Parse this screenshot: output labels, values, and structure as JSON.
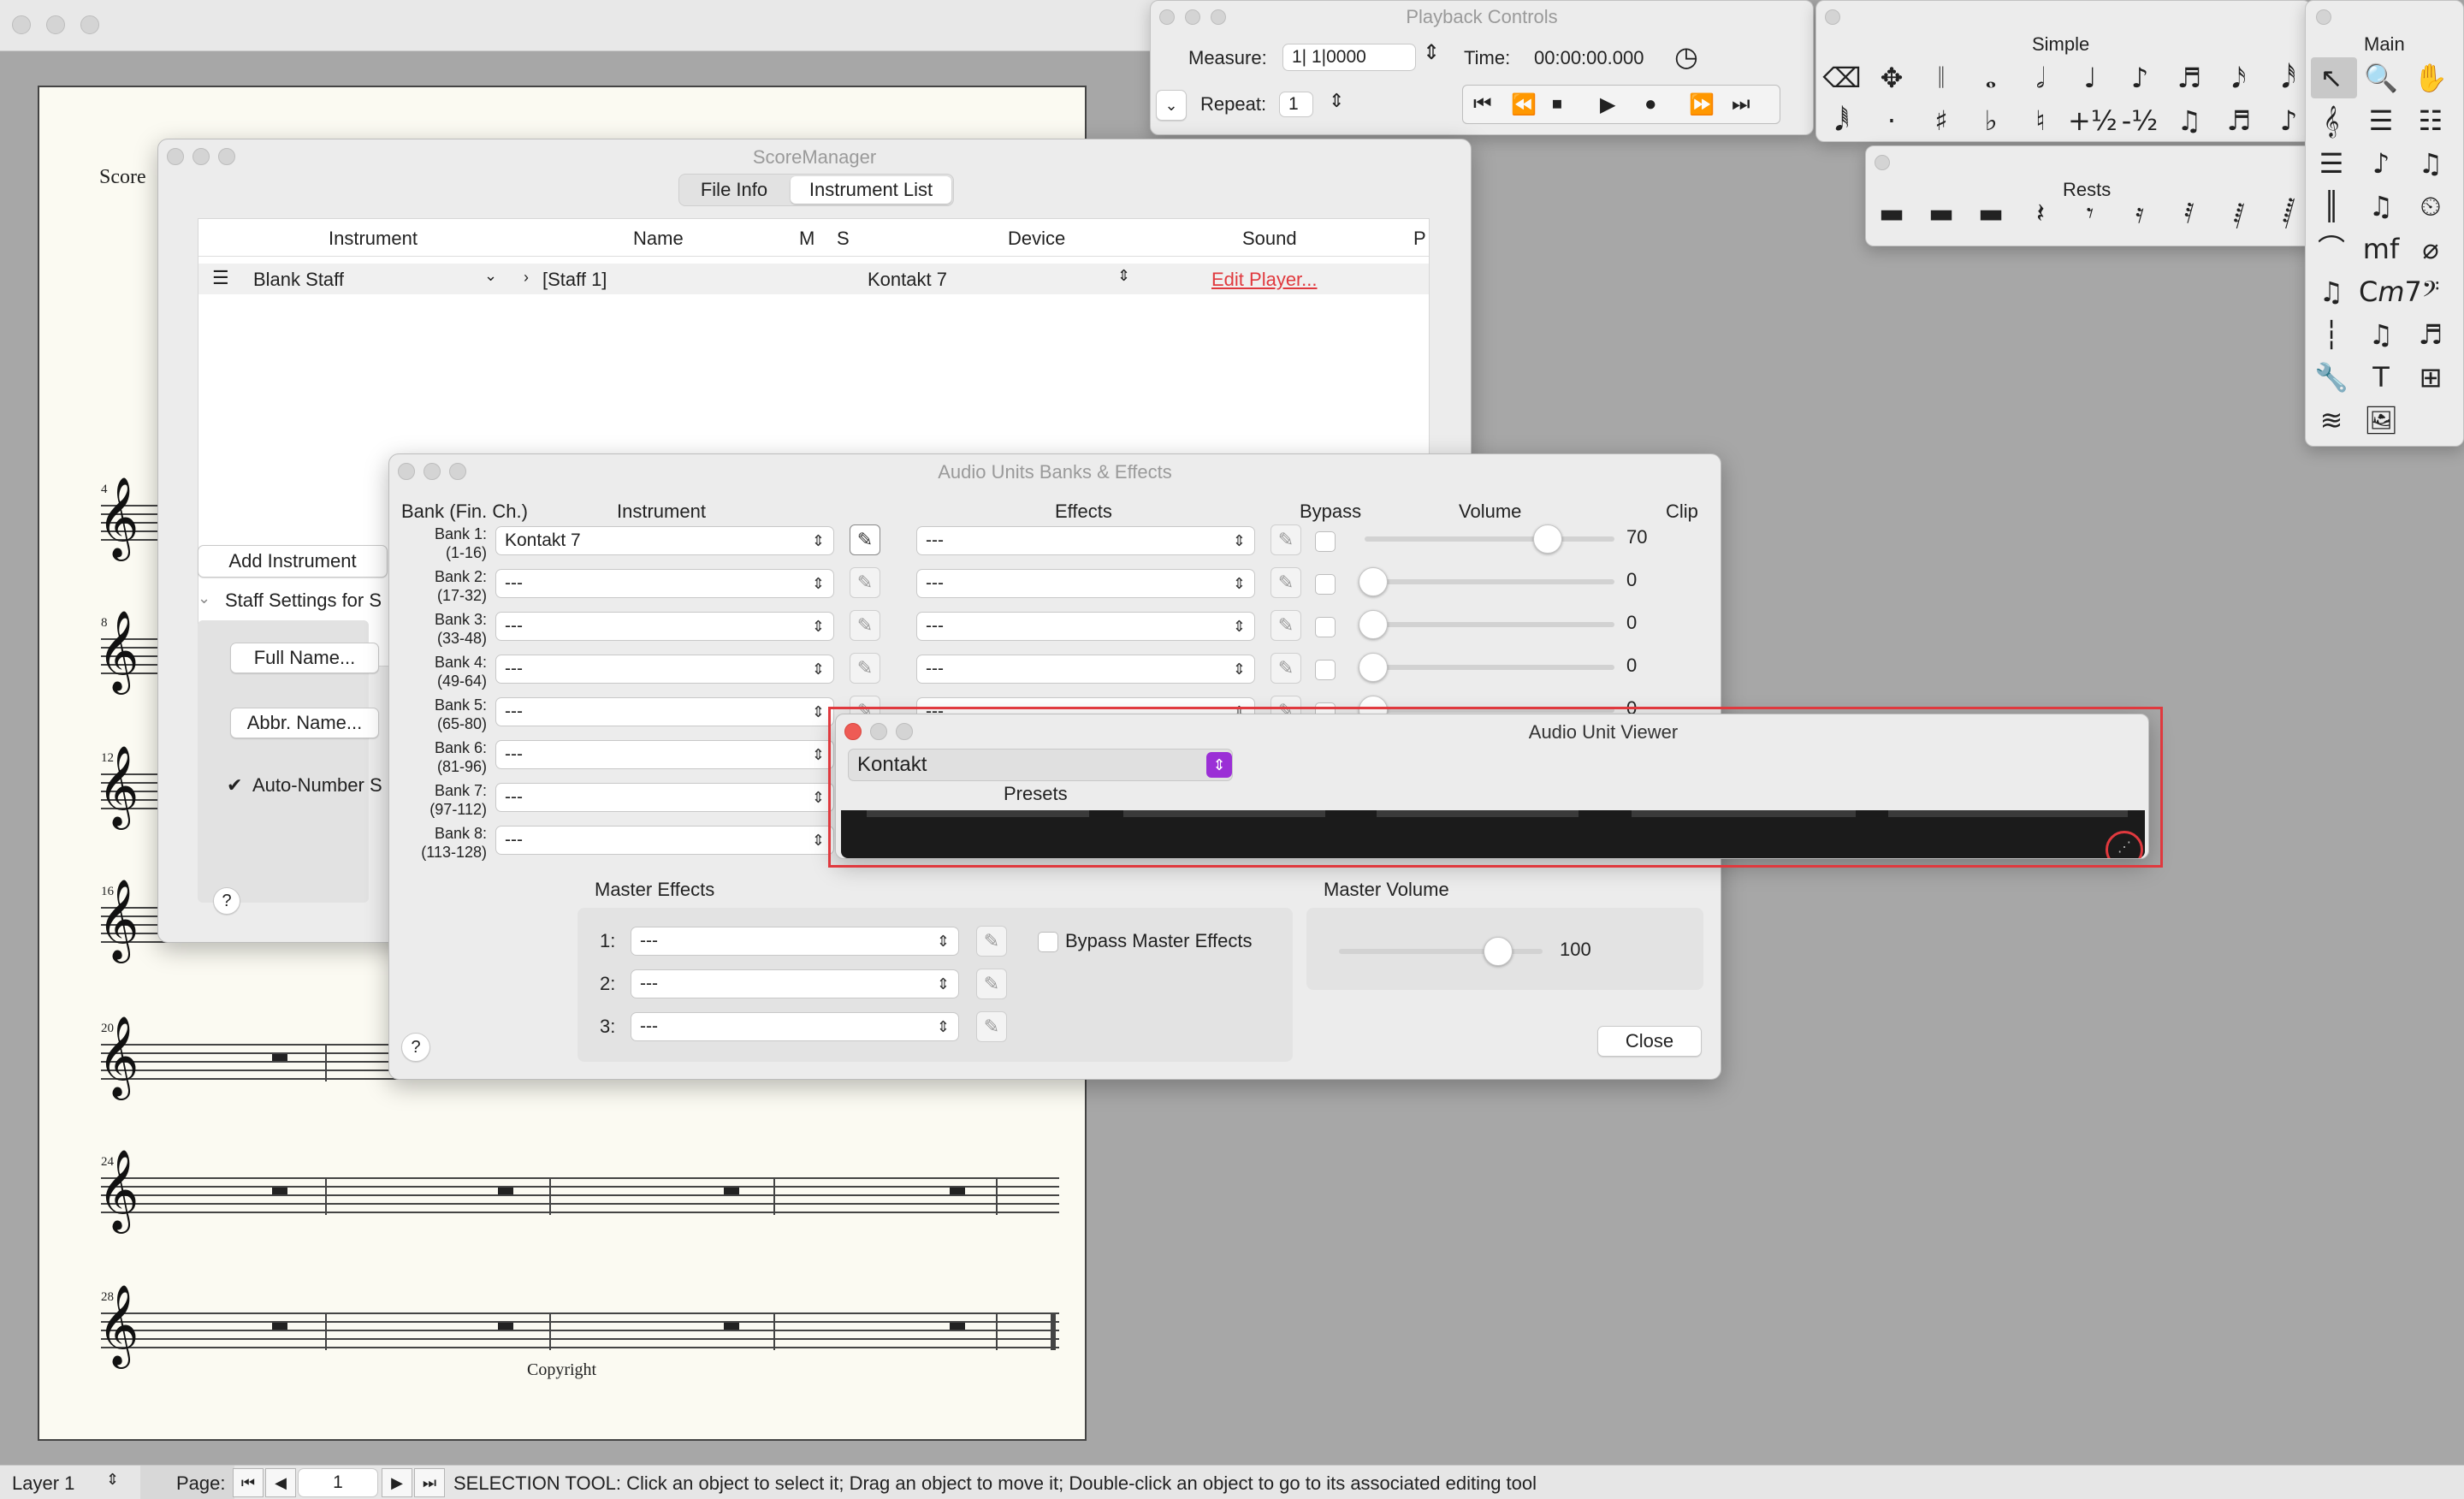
{
  "score": {
    "label": "Score",
    "measure_numbers": [
      "4",
      "8",
      "12",
      "16",
      "20",
      "24",
      "28"
    ],
    "copyright": "Copyright"
  },
  "score_manager": {
    "title": "ScoreManager",
    "tabs": [
      "File Info",
      "Instrument List"
    ],
    "active_tab": "Instrument List",
    "columns": [
      "Instrument",
      "Name",
      "M",
      "S",
      "Device",
      "Sound",
      "P"
    ],
    "row": {
      "instrument": "Blank Staff",
      "name": "[Staff 1]",
      "device": "Kontakt 7",
      "sound": "Edit Player..."
    },
    "add_instrument": "Add Instrument",
    "staff_settings": "Staff Settings for S",
    "full_name": "Full Name...",
    "abbr_name": "Abbr. Name...",
    "auto_number": "Auto-Number S",
    "help": "?"
  },
  "playback": {
    "title": "Playback Controls",
    "measure_label": "Measure:",
    "measure_value": "1| 1|0000",
    "time_label": "Time:",
    "time_value": "00:00:00.000",
    "repeat_label": "Repeat:",
    "repeat_value": "1"
  },
  "palettes": {
    "simple_title": "Simple",
    "main_title": "Main",
    "rests_title": "Rests",
    "simple_tools": [
      "⌫",
      "✥",
      "𝄁",
      "𝅝",
      "𝅗𝅥",
      "♩",
      "♪",
      "♬",
      "𝅘𝅥𝅯",
      "𝅘𝅥𝅰",
      "𝅘𝅥𝅱",
      "·",
      "♯",
      "♭",
      "♮",
      "+½",
      "-½",
      "♫",
      "♬",
      "♪"
    ],
    "rest_tools": [
      "▬",
      "▬",
      "▬",
      "𝄽",
      "𝄾",
      "𝄿",
      "𝅀",
      "𝅁",
      "𝅂"
    ],
    "main_tools": [
      "↖",
      "🔍",
      "✋",
      "𝄞",
      "☰",
      "☷",
      "☰",
      "♪",
      "♫",
      "║",
      "♫",
      "⏲",
      "⌒",
      "mf",
      "⌀",
      "♫",
      "C𝘮7",
      "𝄢",
      "┆",
      "♫",
      "♬",
      "🔧",
      "T",
      "⊞",
      "≋",
      "🖼"
    ]
  },
  "audio_units": {
    "title": "Audio Units Banks & Effects",
    "headers": {
      "bank": "Bank (Fin. Ch.)",
      "instrument": "Instrument",
      "effects": "Effects",
      "bypass": "Bypass",
      "volume": "Volume",
      "clip": "Clip"
    },
    "banks": [
      {
        "name": "Bank 1:",
        "range": "(1-16)",
        "instrument": "Kontakt 7",
        "effect": "---",
        "volume": "70",
        "level": 0.7
      },
      {
        "name": "Bank 2:",
        "range": "(17-32)",
        "instrument": "---",
        "effect": "---",
        "volume": "0",
        "level": 0
      },
      {
        "name": "Bank 3:",
        "range": "(33-48)",
        "instrument": "---",
        "effect": "---",
        "volume": "0",
        "level": 0
      },
      {
        "name": "Bank 4:",
        "range": "(49-64)",
        "instrument": "---",
        "effect": "---",
        "volume": "0",
        "level": 0
      },
      {
        "name": "Bank 5:",
        "range": "(65-80)",
        "instrument": "---",
        "effect": "---",
        "volume": "0",
        "level": 0
      },
      {
        "name": "Bank 6:",
        "range": "(81-96)",
        "instrument": "---"
      },
      {
        "name": "Bank 7:",
        "range": "(97-112)",
        "instrument": "---"
      },
      {
        "name": "Bank 8:",
        "range": "(113-128)",
        "instrument": "---"
      }
    ],
    "master_effects_label": "Master Effects",
    "master_effects": [
      {
        "num": "1:",
        "value": "---"
      },
      {
        "num": "2:",
        "value": "---"
      },
      {
        "num": "3:",
        "value": "---"
      }
    ],
    "bypass_master": "Bypass Master Effects",
    "master_volume_label": "Master Volume",
    "master_volume": "100",
    "master_level": 0.78,
    "close": "Close",
    "help": "?"
  },
  "au_viewer": {
    "title": "Audio Unit Viewer",
    "plugin": "Kontakt",
    "presets": "Presets"
  },
  "status_bar": {
    "layer": "Layer 1",
    "page_label": "Page:",
    "page_value": "1",
    "message": "SELECTION TOOL: Click an object to select it; Drag an object to move it; Double-click an object to go to its associated editing tool"
  },
  "colors": {
    "accent": "#9b2fd6",
    "link": "#e0393e",
    "highlight": "#e0393e"
  }
}
